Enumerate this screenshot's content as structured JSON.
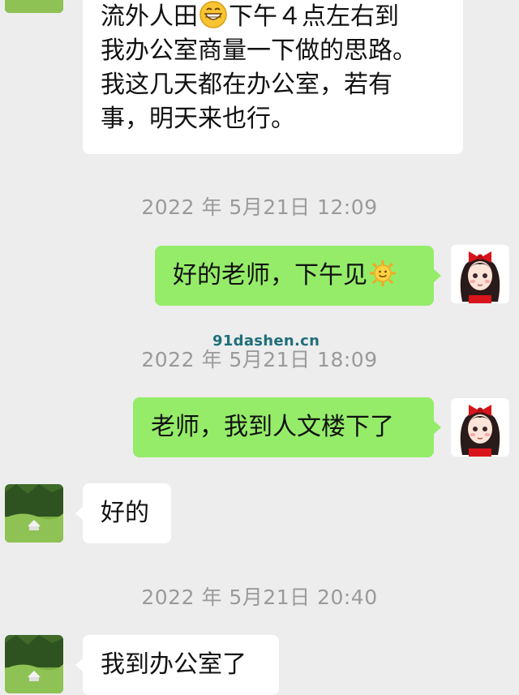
{
  "messages": {
    "m1": {
      "lines": [
        "流外人田",
        "下午４点左右到",
        "我办公室商量一下做的思路。",
        "我这几天都在办公室，若有",
        "事，明天来也行。"
      ],
      "emoji": "grinning-face-emoji"
    },
    "m2": {
      "text": "好的老师，下午见",
      "emoji": "sun-with-face-emoji"
    },
    "m3": {
      "text": "老师，我到人文楼下了"
    },
    "m4": {
      "text": "好的"
    },
    "m5": {
      "text": "我到办公室了"
    }
  },
  "timestamps": {
    "t1": "2022 年 5月21日 12:09",
    "t2": "2022 年 5月21日 18:09",
    "t3": "2022 年 5月21日 20:40"
  },
  "watermark": "91dashen.cn",
  "colors": {
    "background": "#ededed",
    "incoming_bubble": "#ffffff",
    "outgoing_bubble": "#95ec69",
    "timestamp": "#9a9a9a"
  }
}
